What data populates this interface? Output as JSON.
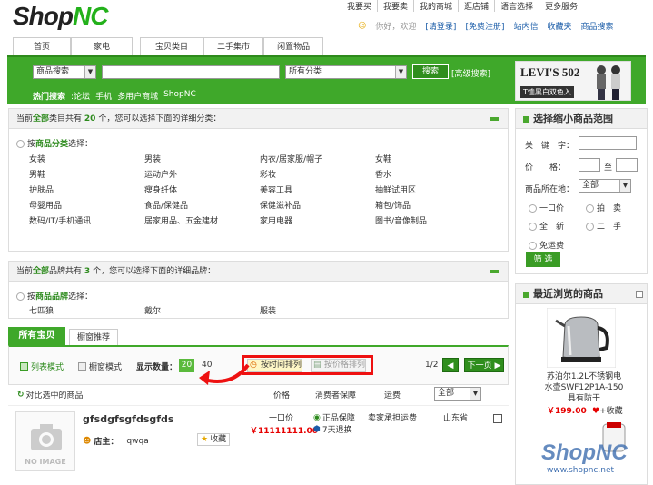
{
  "header": {
    "logo_shop": "Shop",
    "logo_nc": "NC",
    "top_links": [
      "我要买",
      "我要卖",
      "我的商城",
      "逛店铺",
      "语言选择",
      "更多服务"
    ],
    "welcome": "你好，欢迎",
    "login": "[请登录]",
    "register": "[免费注册]",
    "links2": [
      "站内信",
      "收藏夹",
      "商品搜索"
    ]
  },
  "nav": {
    "tabs": [
      "首页",
      "家电",
      "宝贝类目",
      "二手集市",
      "闲置物品"
    ]
  },
  "search": {
    "type_select": "商品搜索",
    "category_select": "所有分类",
    "button": "搜索",
    "advanced": "[高级搜索]",
    "hot_label": "热门搜索",
    "hot_items": [
      ":论坛",
      "手机",
      "多用户商城",
      "ShopNC"
    ]
  },
  "banner": {
    "title": "LEVI'S 502",
    "subtitle": "T恤黑白双色入"
  },
  "category_panel": {
    "prefix": "当前",
    "all": "全部",
    "mid": "类目共有",
    "count": "20",
    "suffix": "个，您可以选择下面的详细分类：",
    "choose_pre": "按",
    "choose_key": "商品分类",
    "choose_post": "选择：",
    "items": [
      "女装",
      "男装",
      "内衣/居家服/帽子",
      "女鞋",
      "男鞋",
      "运动户外",
      "彩妆",
      "香水",
      "护肤品",
      "瘦身纤体",
      "美容工具",
      "抽鲜试用区",
      "母婴用品",
      "食品/保健品",
      "保健滋补品",
      "箱包/饰品",
      "数码/IT/手机通讯",
      "居家用品、五金建材",
      "家用电器",
      "图书/音像制品"
    ]
  },
  "brand_panel": {
    "prefix": "当前",
    "all": "全部",
    "mid": "品牌共有",
    "count": "3",
    "suffix": "个，您可以选择下面的详细品牌：",
    "choose_pre": "按",
    "choose_key": "商品品牌",
    "choose_post": "选择：",
    "items": [
      "七匹狼",
      "戴尔",
      "服装"
    ]
  },
  "filter": {
    "title": "选择缩小商品范围",
    "keyword": "关　键　字：",
    "price": "价　　格：",
    "to": "至",
    "location": "商品所在地：",
    "location_value": "全部",
    "options": [
      "一口价",
      "拍　卖",
      "全　新",
      "二　手",
      "免运费"
    ],
    "button": "筛 选"
  },
  "recent": {
    "title": "最近浏览的商品",
    "product_name": "苏泊尔1.2L不锈钢电水壶SWF12P1A-150　具有防干",
    "price": "￥199.00",
    "fav": "+收藏"
  },
  "watermark": {
    "brand": "ShopNC",
    "url": "www.shopnc.net"
  },
  "list": {
    "tab_all": "所有宝贝",
    "tab_window": "橱窗推荐",
    "mode_list": "列表模式",
    "mode_window": "橱窗模式",
    "show_count": "显示数量：",
    "count_20": "20",
    "count_40": "40",
    "sort_time": "按时间排列",
    "sort_price": "按价格排列",
    "page": "1/2",
    "next": "下一页",
    "compare": "对比选中的商品",
    "col_price": "价格",
    "col_guarantee": "消费者保障",
    "col_shipping": "运费",
    "col_location": "全部",
    "no_image": "NO IMAGE",
    "item_title": "gfsdgfsgfdsgfds",
    "shop_label": "店主：",
    "shop_name": "qwqa",
    "fav": "收藏",
    "price_type": "一口价",
    "price": "￥11111111.00",
    "guarantee1": "正品保障",
    "guarantee2": "7天退换",
    "shipping": "卖家承担运费",
    "location": "山东省"
  },
  "colors": {
    "green": "#3fa82a",
    "dark_green": "#2c8a1c",
    "price_red": "#e60000",
    "highlight_red": "#e11111"
  }
}
